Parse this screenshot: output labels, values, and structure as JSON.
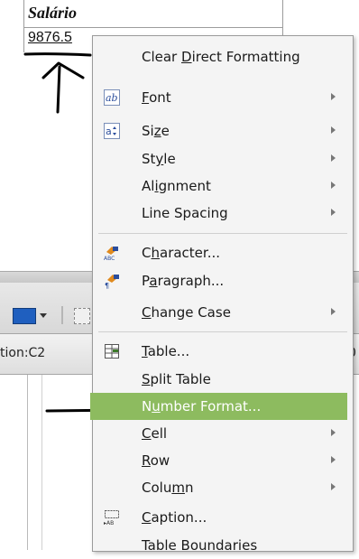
{
  "document": {
    "table_header": "Salário",
    "table_value": "9876.5",
    "status_left": "tion:C2",
    "status_right": "0"
  },
  "context_menu": {
    "items": [
      {
        "label": "Clear Direct Formatting",
        "mnemonic": "D",
        "icon": "",
        "submenu": false,
        "highlighted": false
      },
      {
        "label": "Font",
        "mnemonic": "F",
        "icon": "font-icon",
        "submenu": true,
        "highlighted": false
      },
      {
        "label": "Size",
        "mnemonic": "z",
        "icon": "font-size-icon",
        "submenu": true,
        "highlighted": false
      },
      {
        "label": "Style",
        "mnemonic": "y",
        "icon": "",
        "submenu": true,
        "highlighted": false
      },
      {
        "label": "Alignment",
        "mnemonic": "i",
        "icon": "",
        "submenu": true,
        "highlighted": false
      },
      {
        "label": "Line Spacing",
        "mnemonic": "",
        "icon": "",
        "submenu": true,
        "highlighted": false
      },
      {
        "label": "Character...",
        "mnemonic": "h",
        "icon": "character-icon",
        "submenu": false,
        "highlighted": false
      },
      {
        "label": "Paragraph...",
        "mnemonic": "a",
        "icon": "paragraph-icon",
        "submenu": false,
        "highlighted": false
      },
      {
        "label": "Change Case",
        "mnemonic": "C",
        "icon": "",
        "submenu": true,
        "highlighted": false
      },
      {
        "label": "Table...",
        "mnemonic": "T",
        "icon": "table-icon",
        "submenu": false,
        "highlighted": false
      },
      {
        "label": "Split Table",
        "mnemonic": "S",
        "icon": "",
        "submenu": false,
        "highlighted": false
      },
      {
        "label": "Number Format...",
        "mnemonic": "u",
        "icon": "",
        "submenu": false,
        "highlighted": true
      },
      {
        "label": "Cell",
        "mnemonic": "C",
        "icon": "",
        "submenu": true,
        "highlighted": false
      },
      {
        "label": "Row",
        "mnemonic": "R",
        "icon": "",
        "submenu": true,
        "highlighted": false
      },
      {
        "label": "Column",
        "mnemonic": "m",
        "icon": "",
        "submenu": true,
        "highlighted": false
      },
      {
        "label": "Caption...",
        "mnemonic": "C",
        "icon": "caption-icon",
        "submenu": false,
        "highlighted": false
      },
      {
        "label": "Table Boundaries",
        "mnemonic": "",
        "icon": "",
        "submenu": false,
        "highlighted": false
      }
    ]
  },
  "colors": {
    "menu_background": "#f4f4f4",
    "highlight": "#8dbb5f",
    "annotation": "#000000"
  }
}
